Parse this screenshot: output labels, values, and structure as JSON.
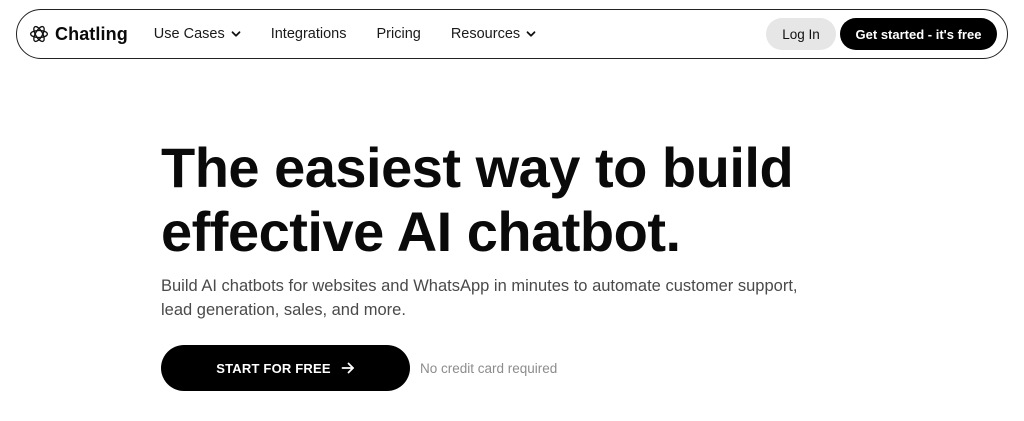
{
  "nav": {
    "brand": "Chatling",
    "items": [
      {
        "label": "Use Cases",
        "has_dropdown": true
      },
      {
        "label": "Integrations",
        "has_dropdown": false
      },
      {
        "label": "Pricing",
        "has_dropdown": false
      },
      {
        "label": "Resources",
        "has_dropdown": true
      }
    ],
    "login_label": "Log In",
    "get_started_label": "Get started - it's free"
  },
  "hero": {
    "headline_line1": "The easiest way to build",
    "headline_line2": "effective AI chatbot.",
    "subtitle": "Build AI chatbots for websites and WhatsApp in minutes to automate customer support, lead generation, sales, and more.",
    "cta_label": "START FOR FREE",
    "note": "No credit card required"
  },
  "icons": {
    "brand": "atom-logo-icon",
    "dropdown": "chevron-down-icon",
    "cta": "arrow-right-icon"
  },
  "colors": {
    "primary_button": "#000000",
    "secondary_button": "#e6e6e6",
    "text": "#0a0a0a",
    "muted_text": "#8c8c8c"
  }
}
